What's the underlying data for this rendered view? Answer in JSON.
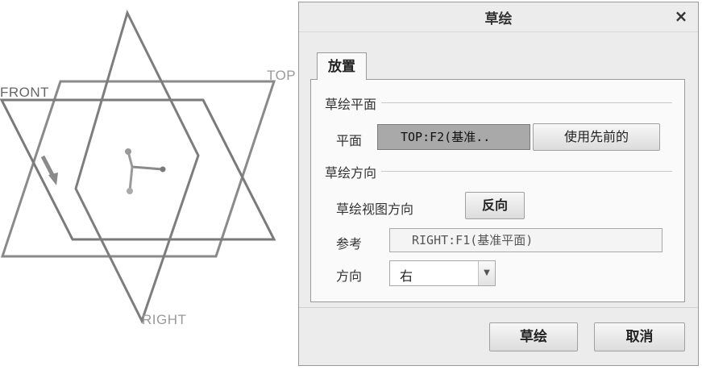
{
  "viewport": {
    "front_label": "FRONT",
    "top_label": "TOP",
    "right_label": "RIGHT"
  },
  "dialog": {
    "title": "草绘",
    "close_glyph": "×",
    "tab_label": "放置",
    "sketch_plane": {
      "section_title": "草绘平面",
      "plane_label": "平面",
      "plane_value": "TOP:F2(基准..",
      "use_previous_label": "使用先前的"
    },
    "sketch_orientation": {
      "section_title": "草绘方向",
      "view_direction_label": "草绘视图方向",
      "flip_label": "反向",
      "reference_label": "参考",
      "reference_value": "RIGHT:F1(基准平面)",
      "orientation_label": "方向",
      "orientation_value": "右"
    },
    "footer": {
      "sketch_button": "草绘",
      "cancel_button": "取消"
    }
  },
  "colors": {
    "plane_edge": "#7d7d7d",
    "selected_field": "#a9a9a9",
    "dialog_bg": "#ececec",
    "panel_bg": "#fafafa"
  }
}
